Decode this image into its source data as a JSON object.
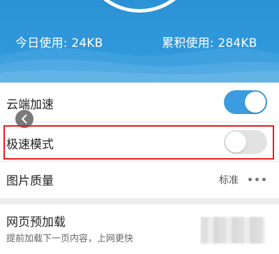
{
  "header": {
    "today_usage": "今日使用: 24KB",
    "total_usage": "累积使用: 284KB"
  },
  "settings": {
    "cloud_acceleration": {
      "label": "云端加速",
      "enabled": true
    },
    "speed_mode": {
      "label": "极速模式",
      "enabled": false
    },
    "image_quality": {
      "label": "图片质量",
      "value": "标准"
    },
    "page_preload": {
      "label": "网页预加载",
      "description": "提前加载下一页内容，上网更快"
    }
  },
  "colors": {
    "header_blue": "#2f98da",
    "toggle_on": "#3b9ce0",
    "toggle_off": "#e2e2e2",
    "highlight_red": "#e01b1b"
  },
  "icons": {
    "back": "chevron-left-icon",
    "more": "more-dots-icon"
  }
}
